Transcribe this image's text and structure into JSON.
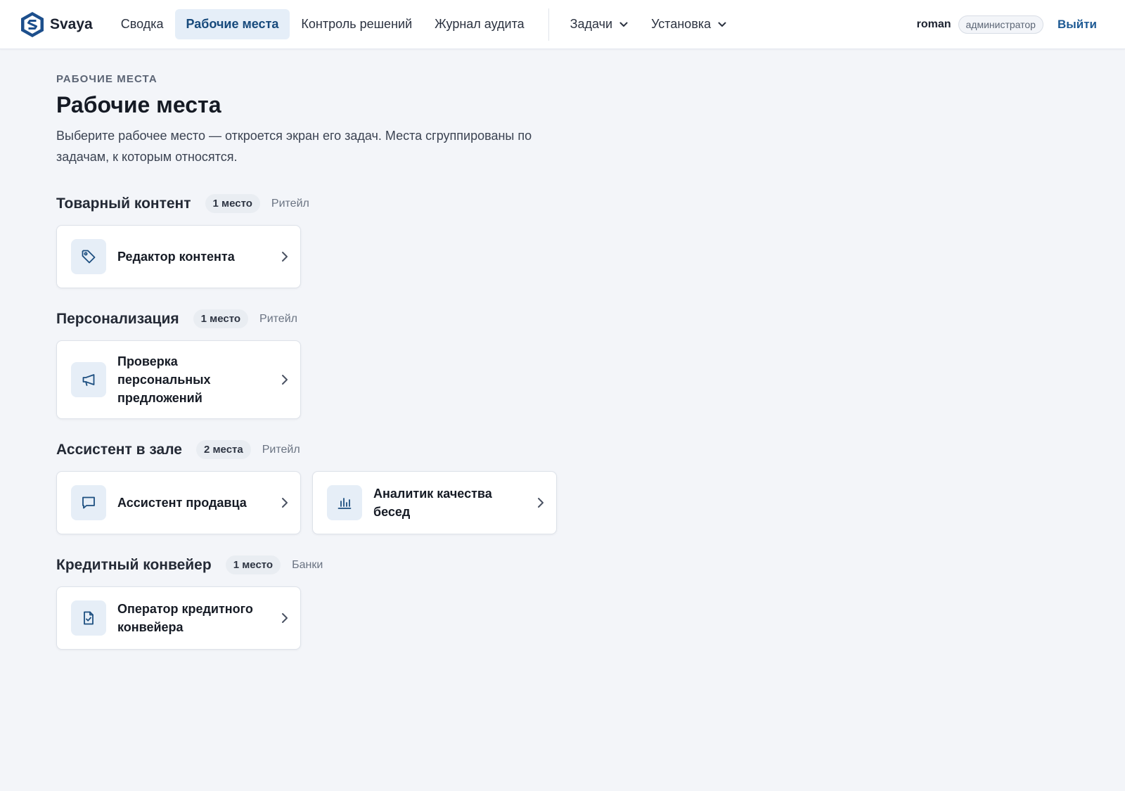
{
  "brand": {
    "name": "Svaya"
  },
  "nav": {
    "items": [
      {
        "label": "Сводка"
      },
      {
        "label": "Рабочие места"
      },
      {
        "label": "Контроль решений"
      },
      {
        "label": "Журнал аудита"
      }
    ],
    "dropdowns": [
      {
        "label": "Задачи",
        "icon": "chevron-down-icon"
      },
      {
        "label": "Установка",
        "icon": "chevron-down-icon"
      }
    ]
  },
  "user": {
    "name": "roman",
    "role": "администратор",
    "logout_label": "Выйти"
  },
  "page": {
    "eyebrow": "РАБОЧИЕ МЕСТА",
    "title": "Рабочие места",
    "description": "Выберите рабочее место — откроется экран его задач. Места сгруппированы по задачам, к которым относятся."
  },
  "groups": [
    {
      "title": "Товарный контент",
      "count": "1 место",
      "tag": "Ритейл",
      "cards": [
        {
          "label": "Редактор контента",
          "icon": "tag-icon"
        }
      ]
    },
    {
      "title": "Персонализация",
      "count": "1 место",
      "tag": "Ритейл",
      "cards": [
        {
          "label": "Проверка персональных предложений",
          "icon": "megaphone-icon"
        }
      ]
    },
    {
      "title": "Ассистент в зале",
      "count": "2 места",
      "tag": "Ритейл",
      "cards": [
        {
          "label": "Ассистент продавца",
          "icon": "chat-bubble-icon"
        },
        {
          "label": "Аналитик качества бесед",
          "icon": "bar-chart-icon"
        }
      ]
    },
    {
      "title": "Кредитный конвейер",
      "count": "1 место",
      "tag": "Банки",
      "cards": [
        {
          "label": "Оператор кредитного конвейера",
          "icon": "document-check-icon"
        }
      ]
    }
  ],
  "colors": {
    "accent": "#1e5a94",
    "icon": "#1d4f80",
    "active_bg": "#e5eef8",
    "page_bg": "#f3f5f9"
  }
}
